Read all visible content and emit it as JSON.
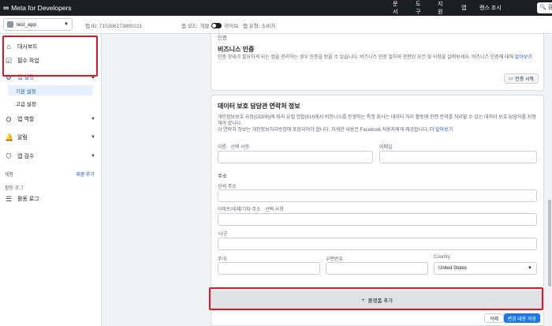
{
  "topnav": {
    "brand": "Meta for Developers",
    "links": [
      "문서",
      "도구",
      "지원",
      "앱",
      "랜스 조시"
    ],
    "search_placeholder": "검"
  },
  "appbar": {
    "app_name": "test_app",
    "app_id": "앱 ID: 715306273890221",
    "mode_label": "앱 모드: 개발",
    "live_label": "라이브",
    "app_type": "앱 유형: 소비자"
  },
  "sidebar": {
    "items": [
      {
        "label": "대시보드",
        "icon": "home-icon"
      },
      {
        "label": "필수 작업",
        "icon": "checklist-icon"
      },
      {
        "label": "앱 설정",
        "icon": "gear-icon"
      },
      {
        "label": "앱 역할",
        "icon": "roles-icon"
      },
      {
        "label": "알림",
        "icon": "bell-icon"
      },
      {
        "label": "앱 검수",
        "icon": "shield-check-icon"
      }
    ],
    "sub_items": [
      "기본 설정",
      "고급 설정"
    ],
    "section_products": "제품",
    "section_products_link": "제품 추가",
    "activity_section": "활동 로그",
    "activity_item": "활동 로그"
  },
  "panel1": {
    "cut_title": "인증",
    "title": "비즈니스 인증",
    "desc": "인증 상태가 필요하게 되는 앱을 관리하는 경우 인증을 받을 수 있습니다. 비즈니스 인증 절차와 관련된 요건 및 이점을 살펴보세요. 비즈니스 인증에 대해",
    "link": "알아보기",
    "button": "인증 시작"
  },
  "panel2": {
    "title": "데이터 보호 담당관 연락처 정보",
    "desc1": "개인정보보호 규정(GDPR)에 따라 유럽 연합(EU)에서 비즈니스를 운영하는 특정 회사는 데이터 처리 활동에 관련 문의를 처리할 수 있는 데이터 보호 담당자를 지정해야 합니다.",
    "desc2": "이 연락처 정보는 개인정보처리방침에 포함되어야 합니다. 자세한 내용은 Facebook 사용자에게 제공합니다.",
    "desc2_link": "더 알아보기",
    "name_label": "이름 · 선택 사항",
    "email_label": "이메일",
    "address_heading": "주소",
    "street_label": "상세 주소",
    "apt_label": "아파트/대체/기타 주소 · 선택 사항",
    "city_label": "시/군",
    "state_label": "주/도",
    "zip_label": "우편번호",
    "country_label": "Country",
    "country_value": "United States"
  },
  "add_row": {
    "label": "플랫폼 추가"
  },
  "footer": {
    "delete": "삭제",
    "save": "변경 내용 저장"
  }
}
